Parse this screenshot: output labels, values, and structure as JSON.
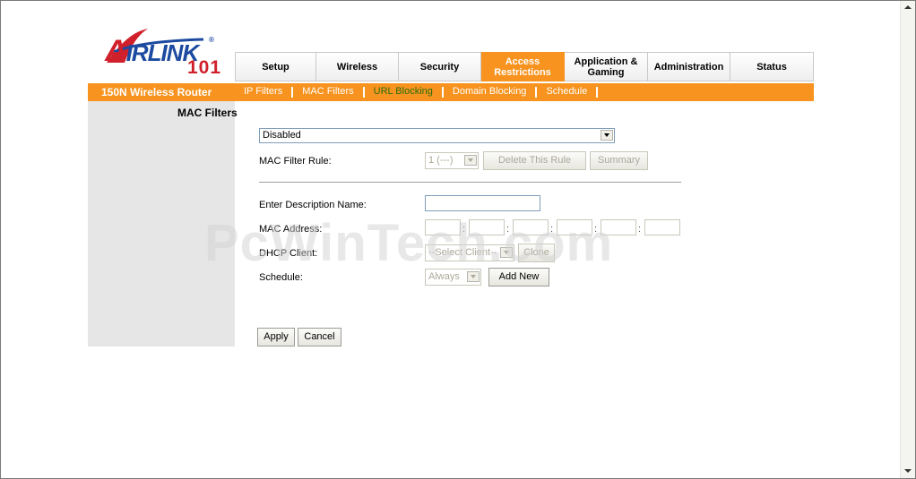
{
  "brand": {
    "logo_text": "AIRLINK",
    "logo_number": "101",
    "router_title": "150N Wireless Router"
  },
  "tabs": [
    {
      "label": "Setup",
      "active": false
    },
    {
      "label": "Wireless",
      "active": false
    },
    {
      "label": "Security",
      "active": false
    },
    {
      "label": "Access\nRestrictions",
      "active": true
    },
    {
      "label": "Application &\nGaming",
      "active": false
    },
    {
      "label": "Administration",
      "active": false
    },
    {
      "label": "Status",
      "active": false
    }
  ],
  "subnav": [
    {
      "label": "IP Filters",
      "active": false
    },
    {
      "label": "MAC Filters",
      "active": false
    },
    {
      "label": "URL Blocking",
      "active": true
    },
    {
      "label": "Domain Blocking",
      "active": false
    },
    {
      "label": "Schedule",
      "active": false
    }
  ],
  "section_title": "MAC Filters",
  "form": {
    "mode_select": "Disabled",
    "mac_filter_rule_label": "MAC Filter Rule:",
    "mac_filter_rule_value": "1 (---)",
    "delete_rule_button": "Delete This Rule",
    "summary_button": "Summary",
    "description_label": "Enter Description Name:",
    "description_value": "",
    "mac_address_label": "MAC Address:",
    "dhcp_client_label": "DHCP Client:",
    "dhcp_client_value": "--Select Client--",
    "clone_button": "Clone",
    "schedule_label": "Schedule:",
    "schedule_value": "Always",
    "add_new_button": "Add New",
    "apply_button": "Apply",
    "cancel_button": "Cancel"
  },
  "watermark": "PcWinTech.com",
  "colors": {
    "accent_orange": "#f7931e",
    "active_subnav": "#2a6e10",
    "left_panel": "#e6e6e6"
  }
}
